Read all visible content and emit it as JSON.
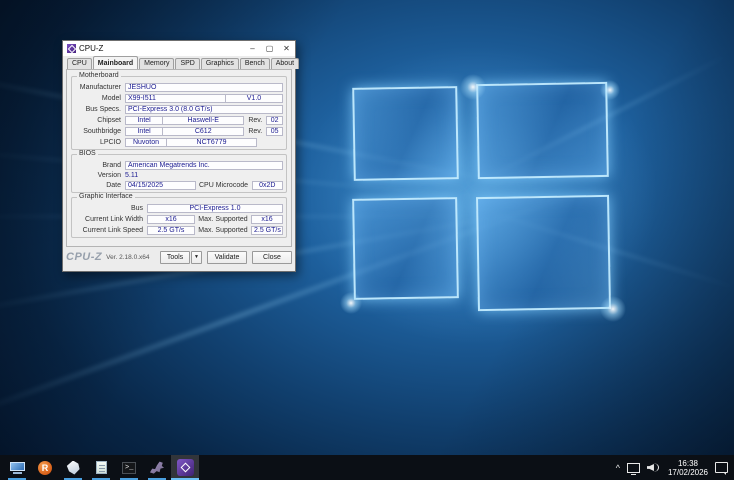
{
  "app": {
    "title": "CPU-Z",
    "titlebar": {
      "minimize": "–",
      "maximize": "▢",
      "close": "✕"
    },
    "tabs": [
      {
        "label": "CPU"
      },
      {
        "label": "Mainboard"
      },
      {
        "label": "Memory"
      },
      {
        "label": "SPD"
      },
      {
        "label": "Graphics"
      },
      {
        "label": "Bench"
      },
      {
        "label": "About"
      }
    ],
    "motherboard": {
      "title": "Motherboard",
      "manufacturer_label": "Manufacturer",
      "manufacturer": "JESHUO",
      "model_label": "Model",
      "model": "X99-I511",
      "model_version": "V1.0",
      "bus_specs_label": "Bus Specs.",
      "bus_specs": "PCI-Express 3.0 (8.0 GT/s)",
      "chipset_label": "Chipset",
      "chipset_vendor": "Intel",
      "chipset_name": "Haswell-E",
      "chipset_rev_label": "Rev.",
      "chipset_rev": "02",
      "southbridge_label": "Southbridge",
      "southbridge_vendor": "Intel",
      "southbridge_name": "C612",
      "southbridge_rev_label": "Rev.",
      "southbridge_rev": "05",
      "lpcio_label": "LPCIO",
      "lpcio_vendor": "Nuvoton",
      "lpcio_name": "NCT6779"
    },
    "bios": {
      "title": "BIOS",
      "brand_label": "Brand",
      "brand": "American Megatrends Inc.",
      "version_label": "Version",
      "version": "5.11",
      "date_label": "Date",
      "date": "04/15/2025",
      "microcode_label": "CPU Microcode",
      "microcode": "0x2D"
    },
    "graphic_interface": {
      "title": "Graphic Interface",
      "bus_label": "Bus",
      "bus": "PCI-Express 1.0",
      "link_width_label": "Current Link Width",
      "link_width": "x16",
      "max_width_label": "Max. Supported",
      "max_width": "x16",
      "link_speed_label": "Current Link Speed",
      "link_speed": "2.5 GT/s",
      "max_speed_label": "Max. Supported",
      "max_speed": "2.5 GT/s"
    },
    "footer": {
      "logo": "CPU-Z",
      "version": "Ver. 2.18.0.x64",
      "tools": "Tools",
      "tools_arrow": "▼",
      "validate": "Validate",
      "close": "Close"
    }
  },
  "taskbar": {
    "glyphs": {
      "r_app": "R",
      "cmd": ">_",
      "chevron": "^"
    },
    "tray": {
      "time": "16:38",
      "date": "17/02/2026"
    }
  },
  "colors": {
    "accent_underline": "#4aa0e0",
    "field_text": "#1a1a90",
    "wallpaper_bright": "#2e7fc2",
    "taskbar_bg": "#0b0f15"
  }
}
